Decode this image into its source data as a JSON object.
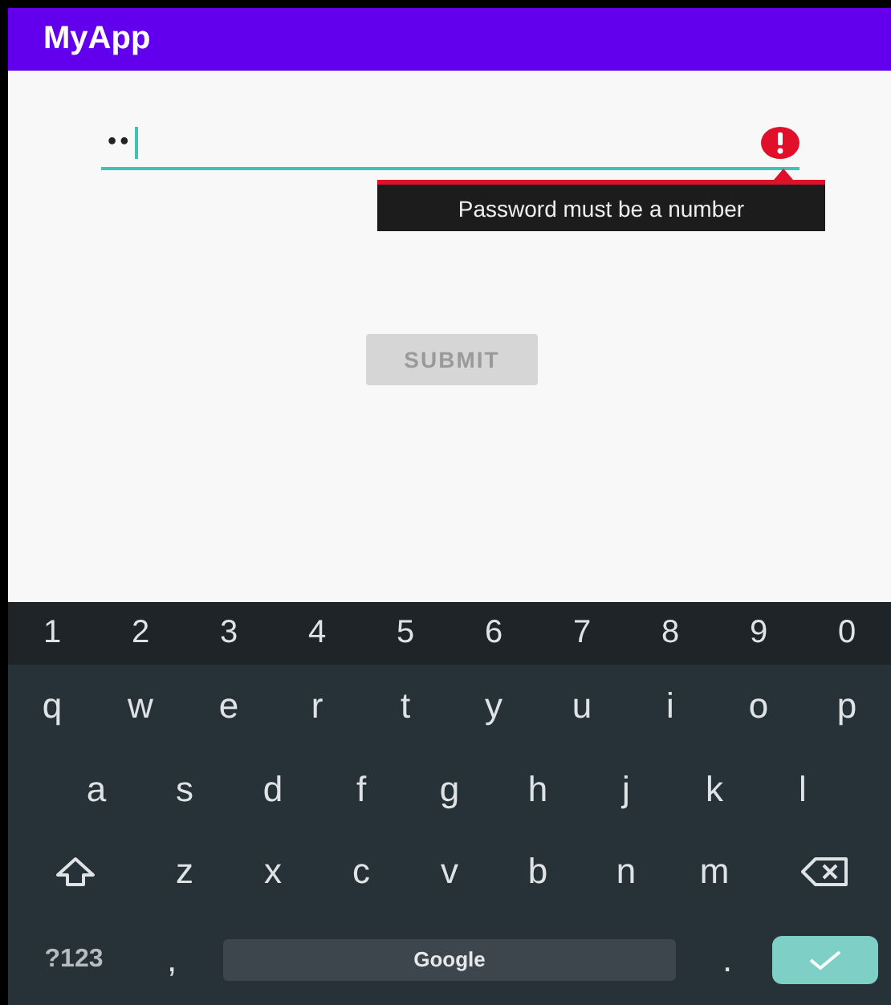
{
  "app_bar": {
    "title": "MyApp"
  },
  "password_field": {
    "value": "••",
    "focused": true,
    "error": "Password must be a number"
  },
  "submit_button": {
    "label": "SUBMIT",
    "disabled": true
  },
  "keyboard": {
    "rows": [
      {
        "kind": "number",
        "keys": [
          "1",
          "2",
          "3",
          "4",
          "5",
          "6",
          "7",
          "8",
          "9",
          "0"
        ]
      },
      {
        "kind": "letter",
        "keys": [
          "q",
          "w",
          "e",
          "r",
          "t",
          "y",
          "u",
          "i",
          "o",
          "p"
        ]
      },
      {
        "kind": "letter",
        "keys": [
          "a",
          "s",
          "d",
          "f",
          "g",
          "h",
          "j",
          "k",
          "l"
        ]
      },
      {
        "kind": "shift",
        "keys": [
          "z",
          "x",
          "c",
          "v",
          "b",
          "n",
          "m"
        ]
      }
    ],
    "bottom": {
      "symbols_key": "?123",
      "comma_key": ",",
      "space_key": "Google",
      "period_key": "."
    }
  }
}
